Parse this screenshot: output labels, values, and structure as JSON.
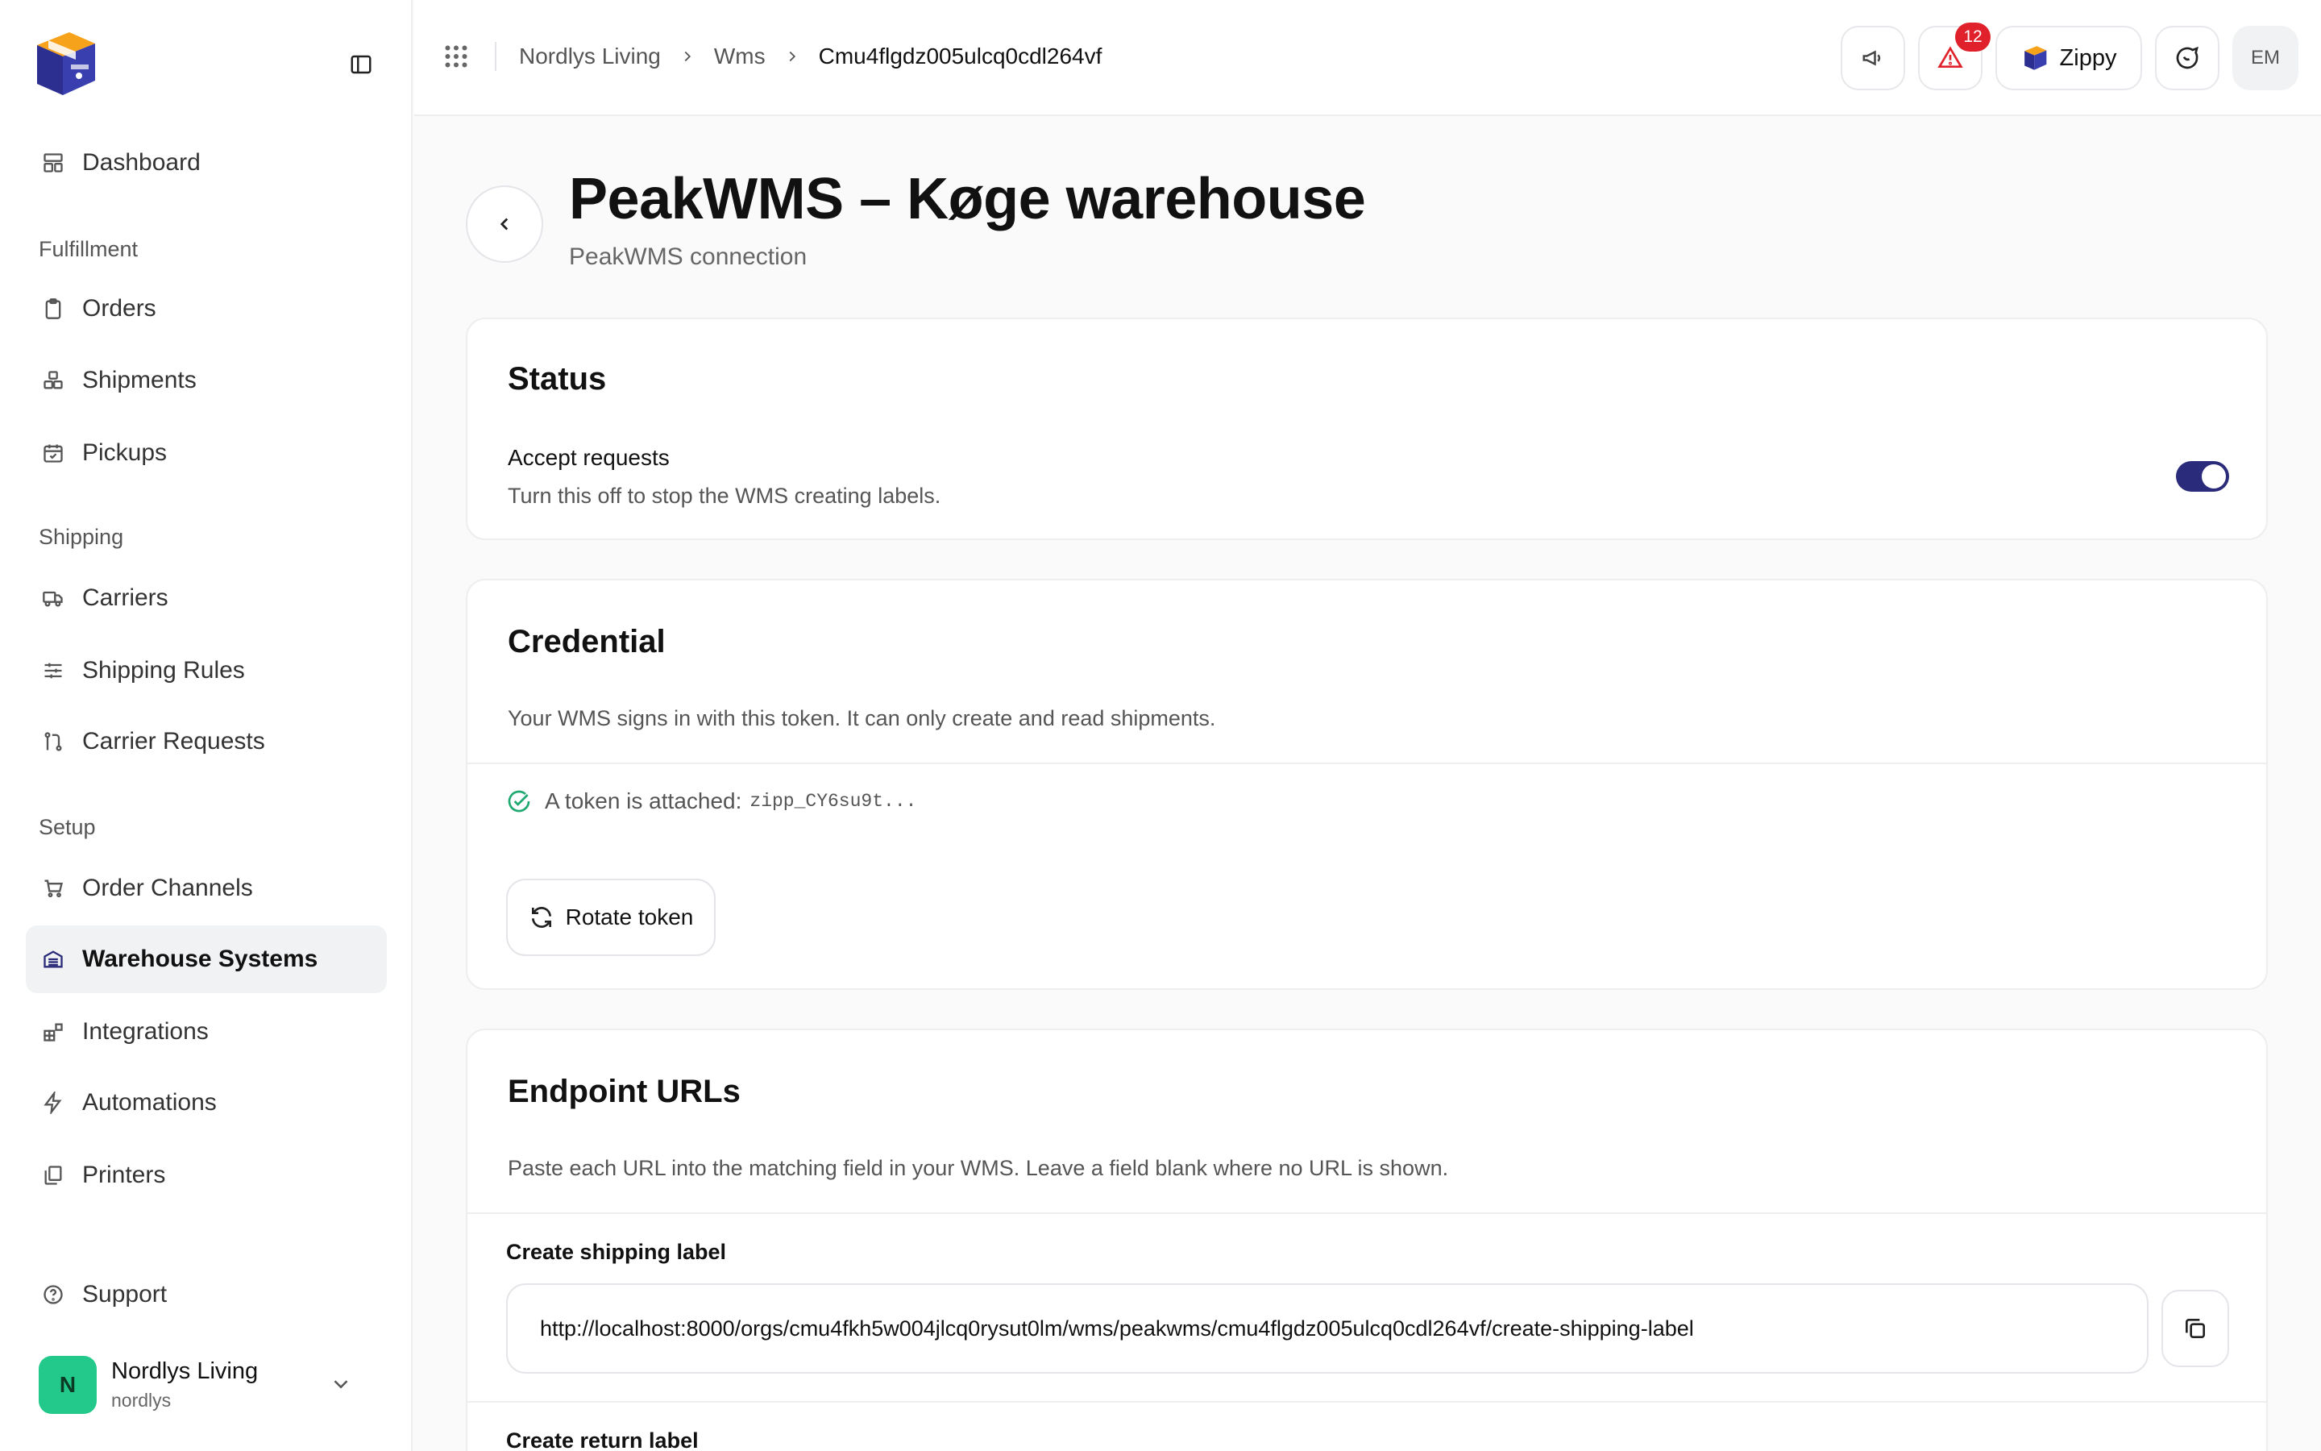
{
  "sidebar": {
    "nav": [
      {
        "label": "Dashboard",
        "icon": "dashboard-icon"
      },
      {
        "label": "Orders",
        "icon": "clipboard-icon"
      },
      {
        "label": "Shipments",
        "icon": "boxes-icon"
      },
      {
        "label": "Pickups",
        "icon": "calendar-check-icon"
      },
      {
        "label": "Carriers",
        "icon": "truck-icon"
      },
      {
        "label": "Shipping Rules",
        "icon": "sliders-icon"
      },
      {
        "label": "Carrier Requests",
        "icon": "git-pull-icon"
      },
      {
        "label": "Order Channels",
        "icon": "cart-icon"
      },
      {
        "label": "Warehouse Systems",
        "icon": "warehouse-icon"
      },
      {
        "label": "Integrations",
        "icon": "blocks-icon"
      },
      {
        "label": "Automations",
        "icon": "bolt-icon"
      },
      {
        "label": "Printers",
        "icon": "printer-copy-icon"
      },
      {
        "label": "Support",
        "icon": "help-circle-icon"
      }
    ],
    "sections": [
      "Fulfillment",
      "Shipping",
      "Setup"
    ],
    "account": {
      "initial": "N",
      "name": "Nordlys Living",
      "handle": "nordlys"
    }
  },
  "topbar": {
    "breadcrumb": [
      "Nordlys Living",
      "Wms",
      "Cmu4flgdz005ulcq0cdl264vf"
    ],
    "notification_count": "12",
    "workspace_label": "Zippy",
    "user_initials": "EM"
  },
  "header": {
    "title": "PeakWMS – Køge warehouse",
    "subtitle": "PeakWMS connection"
  },
  "status_card": {
    "title": "Status",
    "setting_label": "Accept requests",
    "setting_help": "Turn this off to stop the WMS creating labels.",
    "toggle_on": true
  },
  "credential_card": {
    "title": "Credential",
    "description": "Your WMS signs in with this token. It can only create and read shipments.",
    "token_text": "A token is attached:",
    "token_value": "zipp_CY6su9t...",
    "rotate_label": "Rotate token"
  },
  "endpoints_card": {
    "title": "Endpoint URLs",
    "description": "Paste each URL into the matching field in your WMS. Leave a field blank where no URL is shown.",
    "fields": [
      {
        "label": "Create shipping label",
        "value": "http://localhost:8000/orgs/cmu4fkh5w004jlcq0rysut0lm/wms/peakwms/cmu4flgdz005ulcq0cdl264vf/create-shipping-label"
      },
      {
        "label": "Create return label"
      }
    ]
  },
  "colors": {
    "accent": "#2a2b7a",
    "success": "#1fa971",
    "danger": "#e0202a",
    "avatar": "#22c98a"
  }
}
